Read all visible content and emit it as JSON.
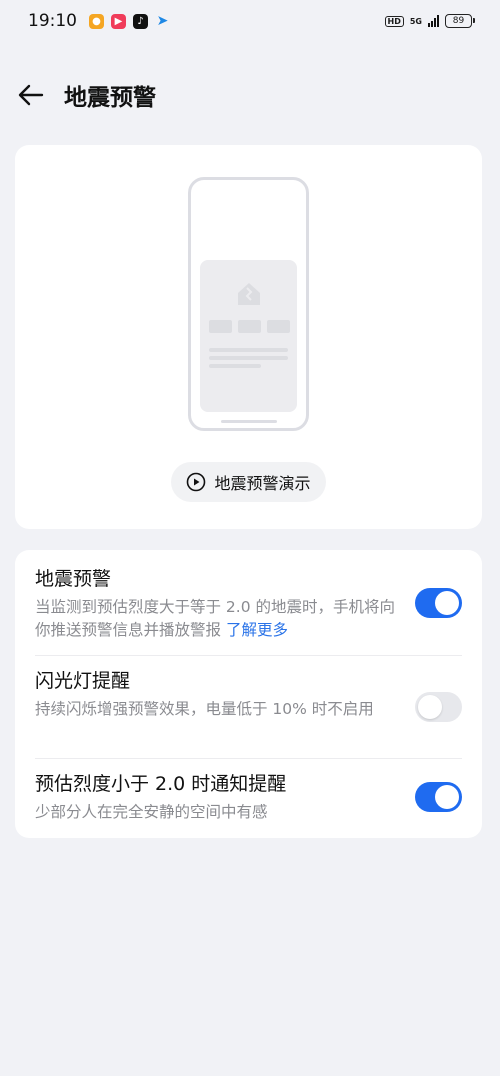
{
  "status": {
    "time": "19:10",
    "hd": "HD",
    "network": "5G",
    "battery": "89"
  },
  "header": {
    "title": "地震预警"
  },
  "demo": {
    "button_label": "地震预警演示"
  },
  "settings": [
    {
      "title": "地震预警",
      "desc": "当监测到预估烈度大于等于 2.0 的地震时，手机将向你推送预警信息并播放警报",
      "link": "了解更多",
      "enabled": true
    },
    {
      "title": "闪光灯提醒",
      "desc": "持续闪烁增强预警效果，电量低于 10% 时不启用",
      "enabled": false
    },
    {
      "title": "预估烈度小于 2.0 时通知提醒",
      "desc": "少部分人在完全安静的空间中有感",
      "enabled": true
    }
  ],
  "colors": {
    "accent": "#1f6bf0",
    "link": "#2a73e8",
    "background": "#f1f2f6"
  }
}
